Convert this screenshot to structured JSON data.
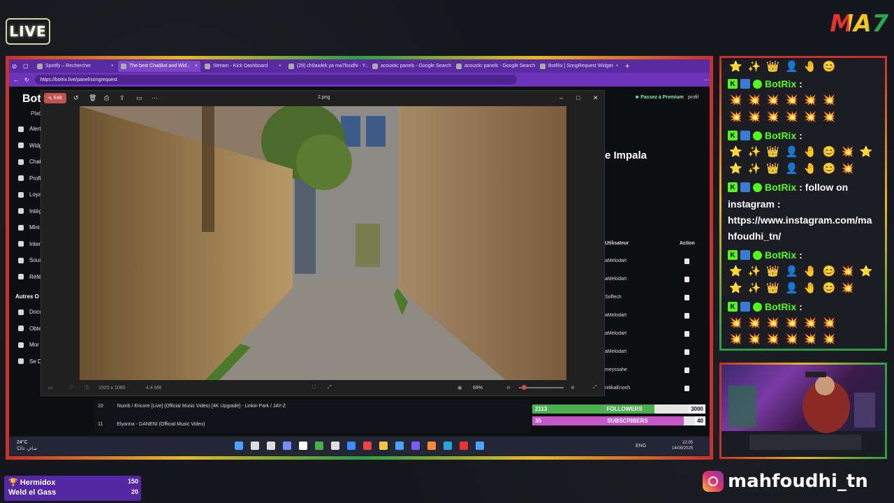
{
  "stream": {
    "live_label": "LIVE",
    "logo_text": "MA7",
    "instagram_handle": "mahfoudhi_tn"
  },
  "browser": {
    "tabs": [
      {
        "label": "Spotify – Rechercher",
        "icon": "spotify-icon",
        "active": false
      },
      {
        "label": "The best ChatBot and Wid...",
        "icon": "botrix-icon",
        "active": true
      },
      {
        "label": "Stream - Kick Dashboard",
        "icon": "kick-icon",
        "active": false
      },
      {
        "label": "(28) ch9awlek ya ma7foudhi - Y...",
        "icon": "youtube-icon",
        "active": false
      },
      {
        "label": "acoustic panels - Google Search",
        "icon": "google-icon",
        "active": false
      },
      {
        "label": "acoustic panels - Google Search",
        "icon": "google-icon",
        "active": false
      },
      {
        "label": "BotRix | SongRequest Widget",
        "icon": "botrix-icon",
        "active": false
      }
    ],
    "url": "https://botrix.live/panel/songrequest"
  },
  "app": {
    "brand": "Bot",
    "sidebar_heading": "Plat",
    "sidebar_items": [
      "Alert",
      "Widg",
      "Chat",
      "Profi",
      "Loya",
      "Intég",
      "Mini",
      "Inter",
      "Sous",
      "Réfé"
    ],
    "other_heading": "Autres O",
    "other_items": [
      "Docu",
      "Obte",
      "Mor",
      "Se D"
    ],
    "premium_label": "Passez à Premium",
    "profile_label": "profil",
    "now_playing_fragment": "e Impala",
    "table": {
      "col_user": "Utilisateur",
      "col_action": "Action",
      "users": [
        "aMelodart",
        "aMelodart",
        "Soffech",
        "aMelodart",
        "aMelodart",
        "aMelodart",
        "meyssahe",
        "nitikaEnoch"
      ]
    },
    "playlist": [
      {
        "num": "10",
        "title": "Numb / Encore [Live] (Official Music Video) [4K Upgrade] - Linkin Park / JAY-Z"
      },
      {
        "num": "11",
        "title": "Elyanna - GANENI (Official Music Video)"
      }
    ]
  },
  "viewer": {
    "edit_label": "Edit",
    "filename": "2.png",
    "dimensions": "1920 x 1080",
    "size": "4.4 MB",
    "zoom": "69%"
  },
  "goals": {
    "followers": {
      "current": "2113",
      "label": "FOLLOWERS",
      "target": "3000",
      "color": "#4caf50"
    },
    "subscribers": {
      "current": "35",
      "label": "SUBSCRIBERS",
      "target": "40",
      "color": "#c657c9"
    }
  },
  "taskbar": {
    "weather_temp": "24°C",
    "weather_desc": "صافٍ غالبًا",
    "lang": "ENG",
    "time": "22:05",
    "date": "14/09/2025"
  },
  "chat": {
    "bot_name": "BotRix",
    "separator": ":",
    "message": "follow on instagram : https://www.instagram.com/mahfoudhi_tn/",
    "message_lines": [
      "follow on",
      "instagram :",
      "https://www.instagram.com/ma",
      "hfoudhi_tn/"
    ]
  },
  "leaderboard": [
    {
      "name": "Hermidox",
      "value": "150"
    },
    {
      "name": "Weld el Gass",
      "value": "20"
    }
  ]
}
